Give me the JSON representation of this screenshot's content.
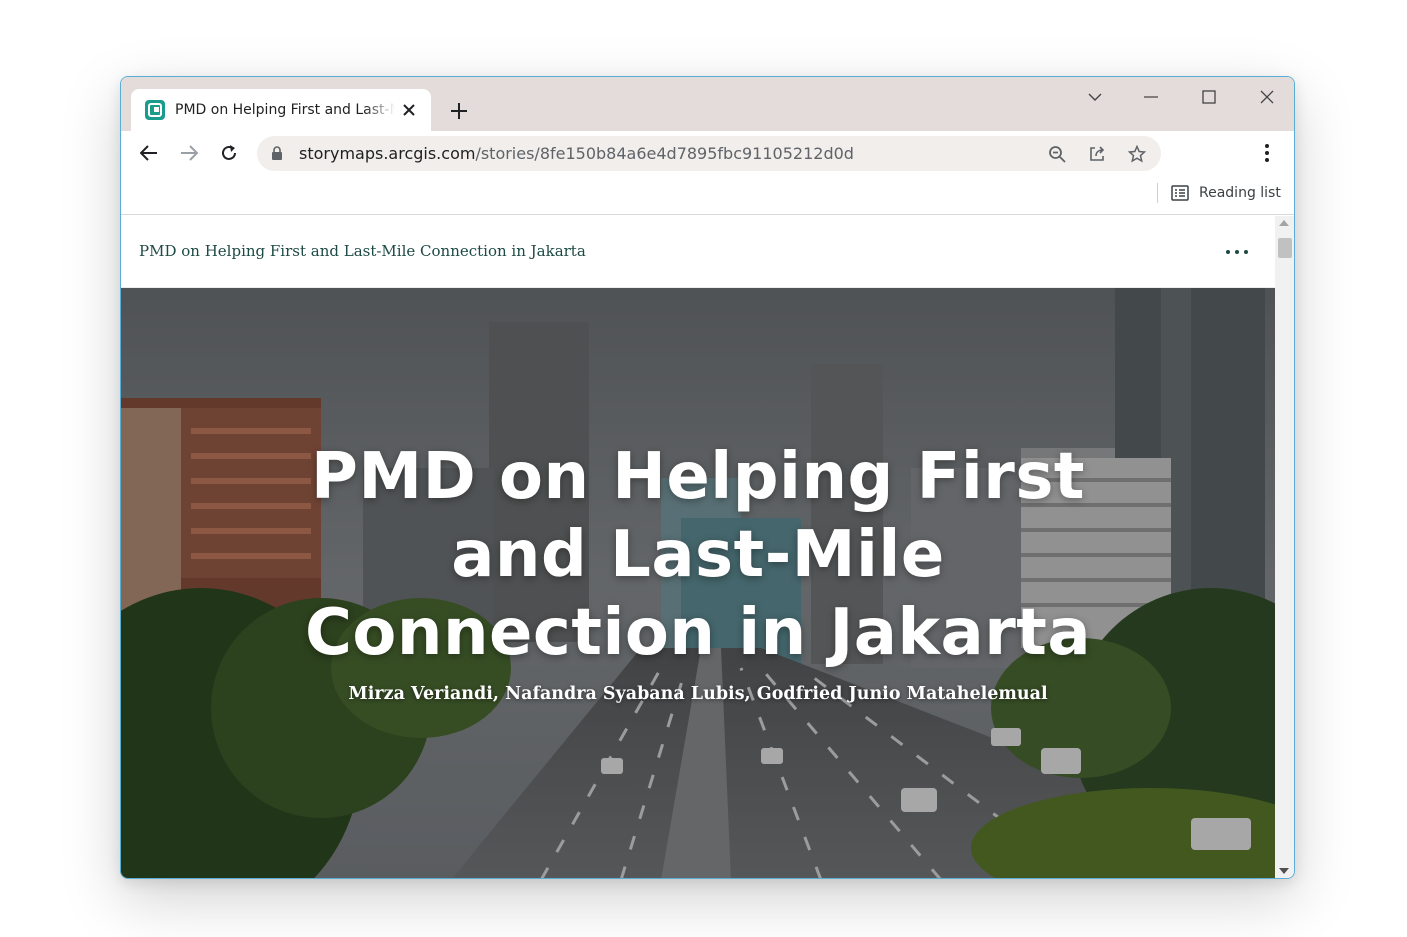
{
  "browser": {
    "tab": {
      "title": "PMD on Helping First and Last-Mile Connection in Jakarta",
      "favicon": "storymaps-icon"
    },
    "address_bar": {
      "host": "storymaps.arcgis.com",
      "path": "/stories/8fe150b84a6e4d7895fbc91105212d0d"
    },
    "bookmarks_bar": {
      "reading_list_label": "Reading list"
    }
  },
  "page": {
    "header": {
      "title": "PMD on Helping First and Last-Mile Connection in Jakarta"
    },
    "hero": {
      "title_lines": [
        "PMD on Helping First",
        "and Last-Mile",
        "Connection in Jakarta"
      ],
      "authors": "Mirza Veriandi, Nafandra Syabana Lubis, Godfried Junio Matahelemual"
    }
  },
  "colors": {
    "window_border": "#5aaed6",
    "tabstrip": "#e3dcda",
    "favicon": "#1a9c8c",
    "header_title": "#1d4a44"
  }
}
